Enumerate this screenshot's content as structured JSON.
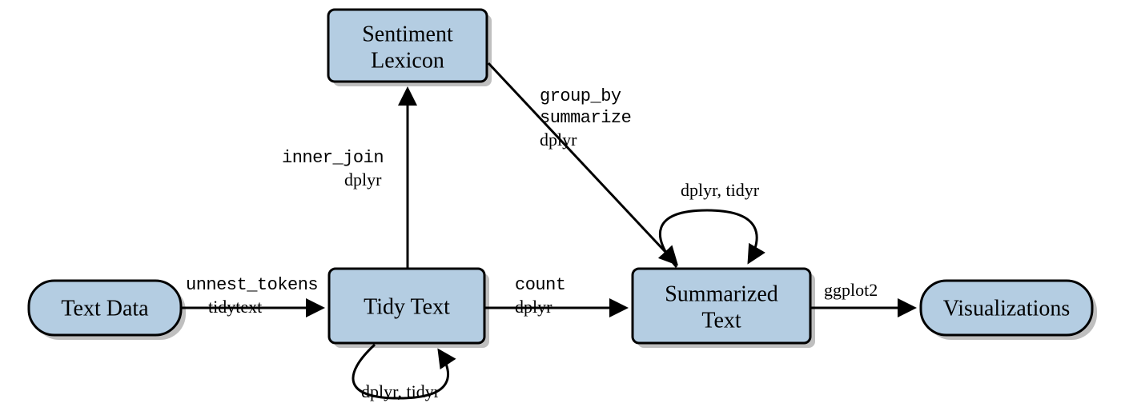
{
  "nodes": {
    "text_data": "Text Data",
    "sentiment_lexicon_l1": "Sentiment",
    "sentiment_lexicon_l2": "Lexicon",
    "tidy_text": "Tidy Text",
    "summarized_l1": "Summarized",
    "summarized_l2": "Text",
    "visualizations": "Visualizations"
  },
  "edges": {
    "unnest_tokens": "unnest_tokens",
    "tidytext": "tidytext",
    "inner_join": "inner_join",
    "dplyr": "dplyr",
    "count": "count",
    "group_by": "group_by",
    "summarize": "summarize",
    "ggplot2": "ggplot2",
    "dplyr_tidyr": "dplyr, tidyr"
  }
}
